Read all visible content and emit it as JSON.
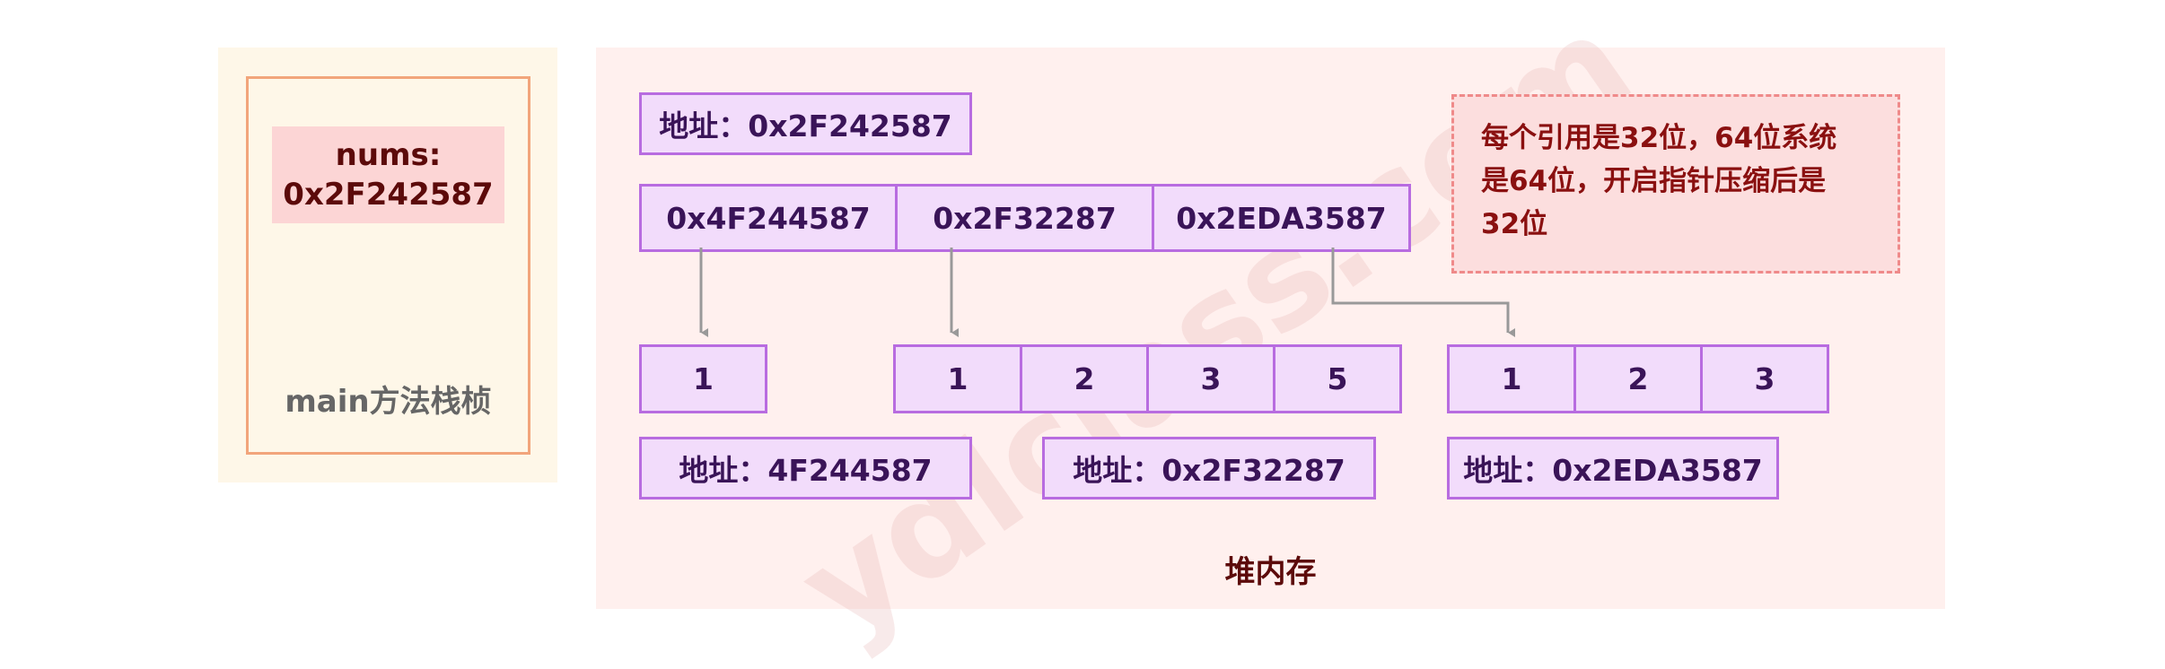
{
  "stack": {
    "var_name": "nums:",
    "var_value": "0x2F242587",
    "label": "main方法栈桢"
  },
  "heap": {
    "label": "堆内存",
    "ref_array_address": "地址：0x2F242587",
    "ref_array": [
      "0x4F244587",
      "0x2F32287",
      "0x2EDA3587"
    ],
    "arrays": [
      {
        "values": [
          "1"
        ],
        "address": "地址：4F244587"
      },
      {
        "values": [
          "1",
          "2",
          "3",
          "5"
        ],
        "address": "地址：0x2F32287"
      },
      {
        "values": [
          "1",
          "2",
          "3"
        ],
        "address": "地址：0x2EDA3587"
      }
    ],
    "note": "每个引用是32位，64位系统\n是64位，开启指针压缩后是\n32位"
  },
  "watermark": "ydlclass.com",
  "colors": {
    "cell_fill": "#f2dcfb",
    "cell_border": "#b86ce0",
    "arrow": "#999999",
    "note_border": "#ef8a8a"
  }
}
